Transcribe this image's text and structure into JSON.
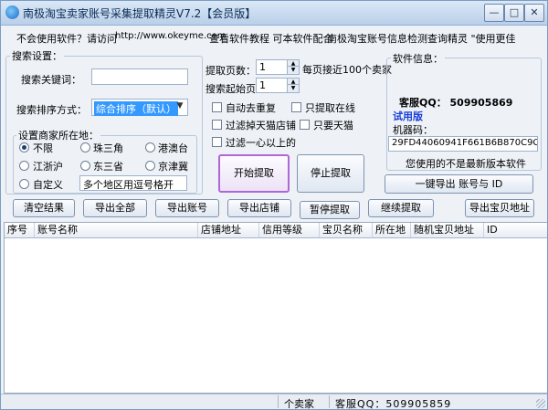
{
  "title": "南极淘宝卖家账号采集提取精灵V7.2【会员版】",
  "window_buttons": {
    "minimize": "—",
    "maximize": "□",
    "close": "✕"
  },
  "toolbar": {
    "question": "不会使用软件？请访问",
    "url": "http://www.okeyme.com",
    "tutorial": "查看软件教程 可本软件配合",
    "promo": "南极淘宝账号信息检测查询精灵 \"使用更佳"
  },
  "search": {
    "group": "搜索设置：",
    "keyword_label": "搜索关键词：",
    "keyword_value": "",
    "sort_label": "搜索排序方式：",
    "sort_value": "综合排序（默认）"
  },
  "location": {
    "group": "设置商家所在地：",
    "options": [
      "不限",
      "珠三角",
      "港澳台",
      "江浙沪",
      "东三省",
      "京津冀",
      "自定义"
    ],
    "selected": "不限",
    "custom_value": "多个地区用逗号格开"
  },
  "extract": {
    "pages_label": "提取页数：",
    "pages_value": "1",
    "pages_note": "每页接近100个卖家",
    "start_label": "搜索起始页：",
    "start_value": "1",
    "options": [
      "自动去重复",
      "只提取在线",
      "过滤掉天猫店铺",
      "只要天猫",
      "过滤一心以上的"
    ],
    "start_button": "开始提取",
    "stop_button": "停止提取"
  },
  "software": {
    "group": "软件信息：",
    "qq_line": "客服QQ：  509905869",
    "version": "试用版",
    "machine_label": "机器码：",
    "machine_code": "29FD44060941F661B6B870C9C",
    "notice": "您使用的不是最新版本软件",
    "export_button": "一键导出 账号与 ID"
  },
  "actions": [
    "清空结果",
    "导出全部",
    "导出账号",
    "导出店铺",
    "暂停提取",
    "继续提取",
    "导出宝贝地址"
  ],
  "table": {
    "columns": [
      "序号",
      "账号名称",
      "店铺地址",
      "信用等级",
      "宝贝名称",
      "所在地",
      "随机宝贝地址",
      "ID"
    ],
    "rows": []
  },
  "status": {
    "count": "个卖家",
    "qq": "客服QQ：509905859"
  }
}
